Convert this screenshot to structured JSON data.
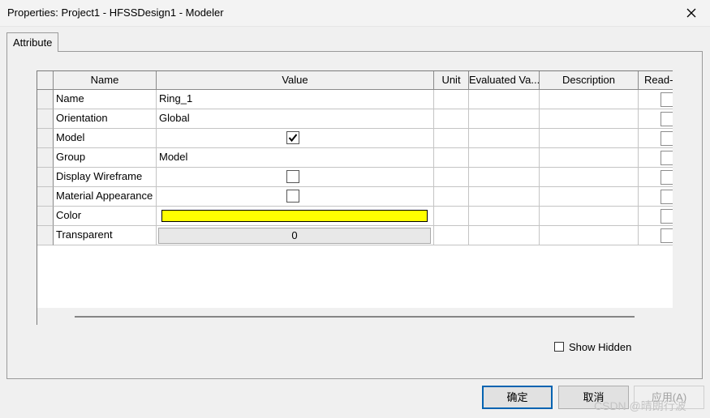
{
  "window": {
    "title": "Properties: Project1 - HFSSDesign1 - Modeler"
  },
  "tabs": [
    {
      "label": "Attribute"
    }
  ],
  "grid": {
    "columns": [
      "Name",
      "Value",
      "Unit",
      "Evaluated Va...",
      "Description",
      "Read-"
    ],
    "rows": [
      {
        "name": "Name",
        "value": "Ring_1"
      },
      {
        "name": "Orientation",
        "value": "Global"
      },
      {
        "name": "Model",
        "value_type": "checkbox",
        "checked": true
      },
      {
        "name": "Group",
        "value": "Model"
      },
      {
        "name": "Display Wireframe",
        "value_type": "checkbox",
        "checked": false
      },
      {
        "name": "Material Appearance",
        "value_type": "checkbox",
        "checked": false
      },
      {
        "name": "Color",
        "value_type": "color",
        "color": "#FFFF00"
      },
      {
        "name": "Transparent",
        "value": "0"
      }
    ]
  },
  "show_hidden": {
    "label": "Show Hidden",
    "checked": false
  },
  "buttons": {
    "ok": "确定",
    "cancel": "取消",
    "apply": "应用(A)"
  },
  "watermark": "CSDN @晴朗行波"
}
